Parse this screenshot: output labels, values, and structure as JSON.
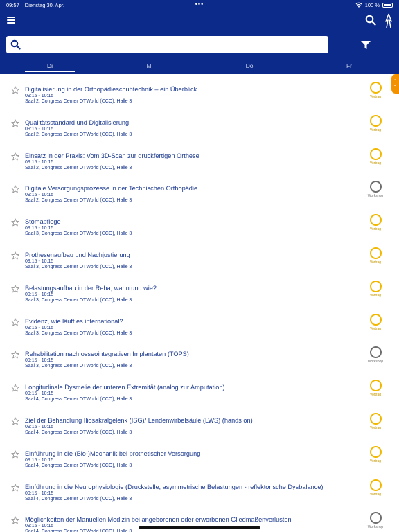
{
  "status_bar": {
    "time": "09:57",
    "date": "Dienstag 30. Apr.",
    "center_dots": "•••",
    "battery": "100 %"
  },
  "search": {
    "placeholder": ""
  },
  "tabs": [
    {
      "label": "Di",
      "active": true
    },
    {
      "label": "Mi",
      "active": false
    },
    {
      "label": "Do",
      "active": false
    },
    {
      "label": "Fr",
      "active": false
    }
  ],
  "items": [
    {
      "title": "Digitalisierung in der Orthopädieschuhtechnik – ein Überblick",
      "time": "09:15 - 10:15",
      "room": "Saal 2, Congress Center OTWorld (CCO), Halle 3",
      "type": "Vortrag"
    },
    {
      "title": "Qualitätsstandard und Digitalisierung",
      "time": "09:15 - 10:15",
      "room": "Saal 2, Congress Center OTWorld (CCO), Halle 3",
      "type": "Vortrag"
    },
    {
      "title": "Einsatz in der Praxis: Vom 3D-Scan zur druckfertigen Orthese",
      "time": "09:15 - 10:15",
      "room": "Saal 2, Congress Center OTWorld (CCO), Halle 3",
      "type": "Vortrag"
    },
    {
      "title": "Digitale Versorgungsprozesse in der Technischen Orthopädie",
      "time": "09:15 - 10:15",
      "room": "Saal 2, Congress Center OTWorld (CCO), Halle 3",
      "type": "Workshop"
    },
    {
      "title": "Stomapflege",
      "time": "09:15 - 10:15",
      "room": "Saal 3, Congress Center OTWorld (CCO), Halle 3",
      "type": "Vortrag"
    },
    {
      "title": "Prothesenaufbau und Nachjustierung",
      "time": "09:15 - 10:15",
      "room": "Saal 3, Congress Center OTWorld (CCO), Halle 3",
      "type": "Vortrag"
    },
    {
      "title": "Belastungsaufbau in der Reha, wann und wie?",
      "time": "09:15 - 10:15",
      "room": "Saal 3, Congress Center OTWorld (CCO), Halle 3",
      "type": "Vortrag"
    },
    {
      "title": "Evidenz, wie läuft es international?",
      "time": "09:15 - 10:15",
      "room": "Saal 3, Congress Center OTWorld (CCO), Halle 3",
      "type": "Vortrag"
    },
    {
      "title": "Rehabilitation nach osseointegrativen Implantaten (TOPS)",
      "time": "09:15 - 10:15",
      "room": "Saal 3, Congress Center OTWorld (CCO), Halle 3",
      "type": "Workshop"
    },
    {
      "title": "Longitudinale Dysmelie der unteren Extremität (analog zur Amputation)",
      "time": "09:15 - 10:15",
      "room": "Saal 4, Congress Center OTWorld (CCO), Halle 3",
      "type": "Vortrag"
    },
    {
      "title": "Ziel der Behandlung Iliosakralgelenk (ISG)/ Lendenwirbelsäule (LWS) (hands on)",
      "time": "09:15 - 10:15",
      "room": "Saal 4, Congress Center OTWorld (CCO), Halle 3",
      "type": "Vortrag"
    },
    {
      "title": "Einführung in die (Bio-)Mechanik  bei prothetischer Versorgung",
      "time": "09:15 - 10:15",
      "room": "Saal 4, Congress Center OTWorld (CCO), Halle 3",
      "type": "Vortrag"
    },
    {
      "title": "Einführung in die Neurophysiologie (Druckstelle, asymmetrische Belastungen - reflektorische Dysbalance)",
      "time": "09:15 - 10:15",
      "room": "Saal 4, Congress Center OTWorld (CCO), Halle 3",
      "type": "Vortrag"
    },
    {
      "title": "Möglichkeiten der Manuellen Medizin bei angeborenen oder erworbenen Gliedmaßenverlusten",
      "time": "09:15 - 10:15",
      "room": "Saal 4, Congress Center OTWorld (CCO), Halle 3",
      "type": "Workshop"
    }
  ],
  "colors": {
    "primary": "#0b2a8a",
    "vortrag": "#f2b800",
    "workshop": "#6e6e6e",
    "accent": "#f39200"
  },
  "icons": [
    "menu-icon",
    "search-icon",
    "logo-icon",
    "filter-icon",
    "star-icon",
    "wifi-icon",
    "battery-icon"
  ]
}
